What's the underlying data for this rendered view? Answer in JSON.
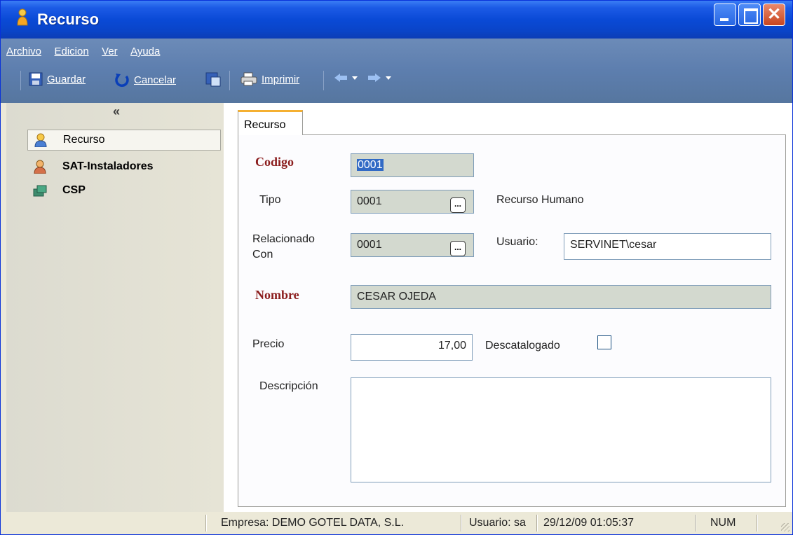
{
  "window": {
    "title": "Recurso"
  },
  "menu": {
    "items": [
      "Archivo",
      "Edicion",
      "Ver",
      "Ayuda"
    ]
  },
  "toolbar": {
    "guardar": "Guardar",
    "cancelar": "Cancelar",
    "imprimir": "Imprimir",
    "icons": [
      "save-icon",
      "undo-icon",
      "save-as-icon",
      "printer-icon",
      "arrow-left-icon",
      "arrow-right-icon"
    ]
  },
  "navigator": {
    "collapse_glyph": "«",
    "items": [
      {
        "label": "Recurso",
        "icon": "person-icon",
        "selected": true
      },
      {
        "label": "SAT-Instaladores",
        "icon": "person-icon",
        "selected": false
      },
      {
        "label": "CSP",
        "icon": "computer-icon",
        "selected": false
      }
    ]
  },
  "tab": {
    "label": "Recurso"
  },
  "form": {
    "codigo_label": "Codigo",
    "codigo_value": "0001",
    "tipo_label": "Tipo",
    "tipo_value": "0001",
    "tipo_description": "Recurso Humano",
    "relacionado_label_1": "Relacionado",
    "relacionado_label_2": "Con",
    "relacionado_value": "0001",
    "usuario_label": "Usuario:",
    "usuario_value": "SERVINET\\cesar",
    "nombre_label": "Nombre",
    "nombre_value": "CESAR OJEDA",
    "precio_label": "Precio",
    "precio_value": "17,00",
    "descatalogado_label": "Descatalogado",
    "descatalogado_checked": false,
    "descripcion_label": "Descripción",
    "descripcion_value": "",
    "ellipsis_glyph": "..."
  },
  "statusbar": {
    "empresa": "Empresa: DEMO GOTEL DATA, S.L.",
    "usuario": "Usuario: sa",
    "datetime": "29/12/09 01:05:37",
    "num": "NUM"
  },
  "colors": {
    "title_blue": "#0a4ad6",
    "toolbar_blue": "#5d7eae",
    "required_label": "#8b1d1d",
    "readonly_field": "#d3d9cf",
    "tab_accent": "#f5b031"
  }
}
